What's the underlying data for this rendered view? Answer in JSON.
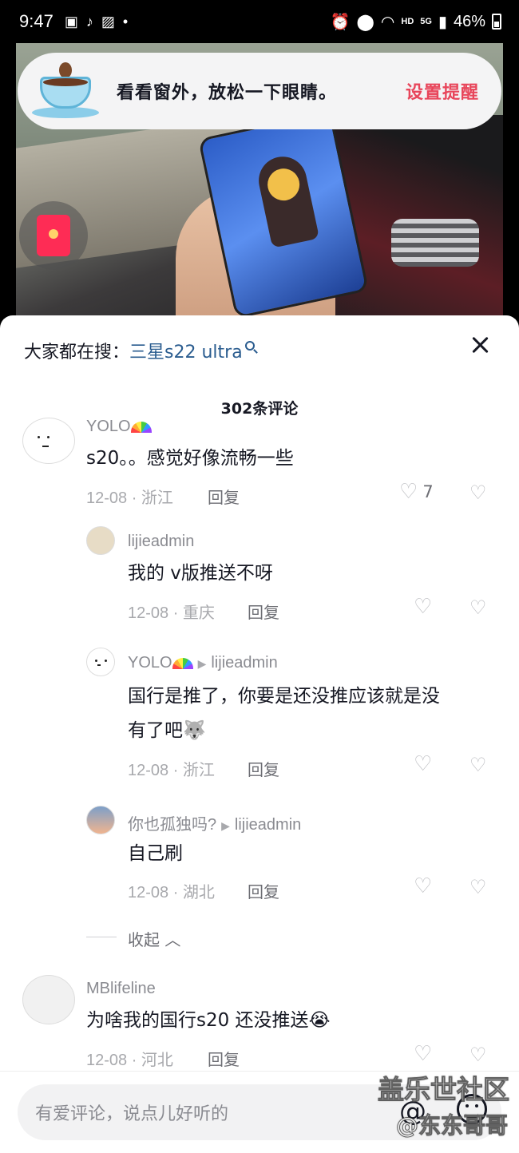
{
  "status_bar": {
    "time": "9:47",
    "left_icons": [
      "notification-icon",
      "tiktok-icon",
      "gallery-icon",
      "dot-icon"
    ],
    "hd_label": "HD",
    "network_label": "5G",
    "battery": "46%"
  },
  "tip_banner": {
    "message": "看看窗外，放松一下眼睛。",
    "action": "设置提醒"
  },
  "search": {
    "prefix": "大家都在搜：",
    "query": "三星s22 ultra"
  },
  "comment_count": "302条评论",
  "comments": [
    {
      "user": "YOLO",
      "text": "s20。。感觉好像流畅一些",
      "meta": "12-08 · 浙江",
      "reply_label": "回复",
      "likes": "7"
    },
    {
      "user": "lijieadmin",
      "text": "我的 v版推送不呀",
      "meta": "12-08 · 重庆",
      "reply_label": "回复"
    },
    {
      "user": "YOLO",
      "reply_to": "lijieadmin",
      "text_line1": "国行是推了，你要是还没推应该就是没",
      "text_line2": "有了吧",
      "meta": "12-08 · 浙江",
      "reply_label": "回复"
    },
    {
      "user": "你也孤独吗?",
      "reply_to": "lijieadmin",
      "text": "自己刷",
      "meta": "12-08 · 湖北",
      "reply_label": "回复"
    },
    {
      "user": "MBlifeline",
      "text": "为啥我的国行s20 还没推送",
      "meta": "12-08 · 河北",
      "reply_label": "回复"
    }
  ],
  "collapse_label": "收起",
  "input": {
    "placeholder": "有爱评论，说点儿好听的"
  },
  "watermark": {
    "line1": "盖乐世社区",
    "line2": "@东东哥哥"
  }
}
